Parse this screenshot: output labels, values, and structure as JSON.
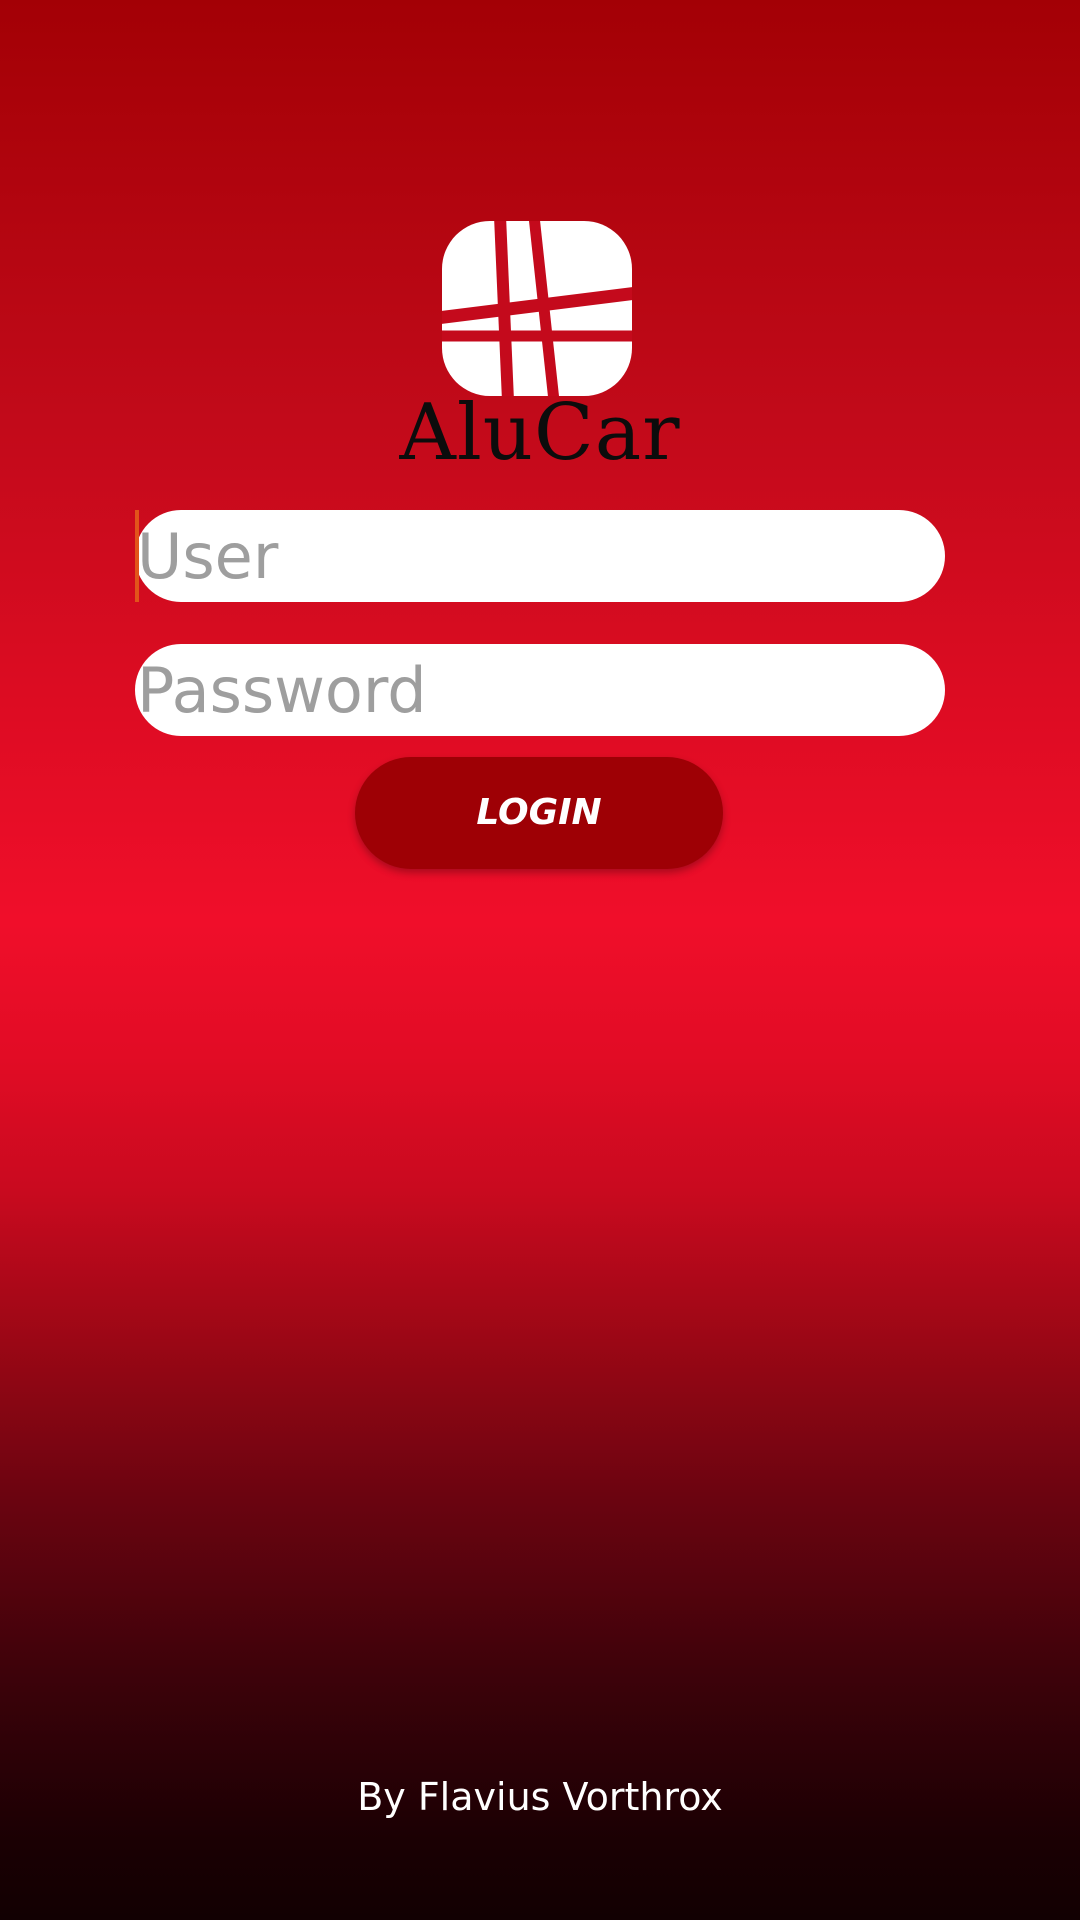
{
  "app": {
    "logo_text": "AluCar",
    "logo_icon": "grid-logo-icon"
  },
  "form": {
    "user_placeholder": "User",
    "user_value": "",
    "password_placeholder": "Password",
    "password_value": "",
    "login_label": "LOGIN"
  },
  "footer": {
    "credit": "By Flavius Vorthrox"
  },
  "colors": {
    "background_top": "#a30005",
    "background_mid": "#f00e2a",
    "background_bottom": "#120002",
    "button": "#9e0005",
    "caret": "#e2541a",
    "placeholder": "#9e9e9e"
  }
}
